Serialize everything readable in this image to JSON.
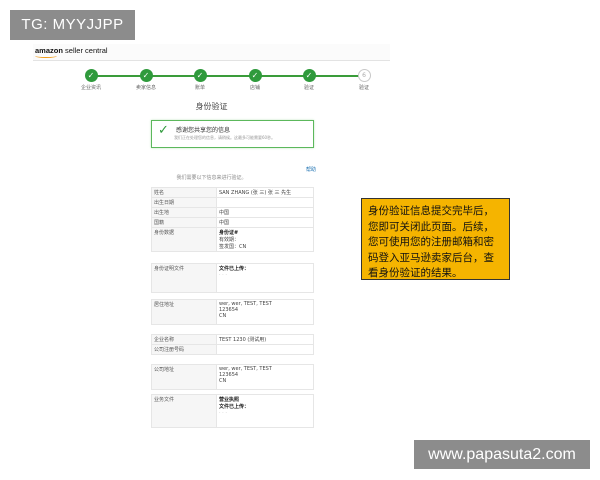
{
  "badges": {
    "tg": "TG: MYYJJPP",
    "watermark": "www.papasuta2.com"
  },
  "header": {
    "logo_brand": "amazon",
    "logo_sub": " seller central"
  },
  "steps": [
    {
      "label": "企业资讯",
      "icon": "✓"
    },
    {
      "label": "卖家信息",
      "icon": "✓"
    },
    {
      "label": "账单",
      "icon": "✓"
    },
    {
      "label": "店铺",
      "icon": "✓"
    },
    {
      "label": "验证",
      "icon": "✓"
    },
    {
      "label": "验证",
      "icon": "6"
    }
  ],
  "page_title": "身份验证",
  "success": {
    "title": "感谢您共享您的信息",
    "subtitle": "我们正在处理您的信息，请稍候。这最多可能需要60秒。"
  },
  "help": "帮助",
  "intro": "我们需要以下信息来进行验证。",
  "table1": [
    {
      "k": "姓名",
      "v": "SAN ZHANG (张 三)  张 三 先生"
    },
    {
      "k": "出生日期",
      "v": ""
    },
    {
      "k": "出生地",
      "v": "中国"
    },
    {
      "k": "国籍",
      "v": "中国"
    },
    {
      "k": "身份数据",
      "v1": "身份证#",
      "v2": "有效期：",
      "v3": "签发国：CN"
    }
  ],
  "table2": {
    "k": "身份证明文件",
    "v": "文件已上传："
  },
  "table3": {
    "k": "居住地址",
    "lines": [
      "wer, wer, TEST, TEST",
      "123654",
      "CN"
    ]
  },
  "table4": [
    {
      "k": "企业名称",
      "v": "TEST 1230 (测试用)"
    },
    {
      "k": "公司注册号码",
      "v": ""
    }
  ],
  "table5": {
    "k": "公司地址",
    "lines": [
      "wer, wer, TEST, TEST",
      "123654",
      "CN"
    ]
  },
  "table6": {
    "k": "业务文件",
    "v1": "营业执照",
    "v2": "文件已上传："
  },
  "callout": "身份验证信息提交完毕后，您即可关闭此页面。后续，您可使用您的注册邮箱和密码登入亚马逊卖家后台，查看身份验证的结果。"
}
